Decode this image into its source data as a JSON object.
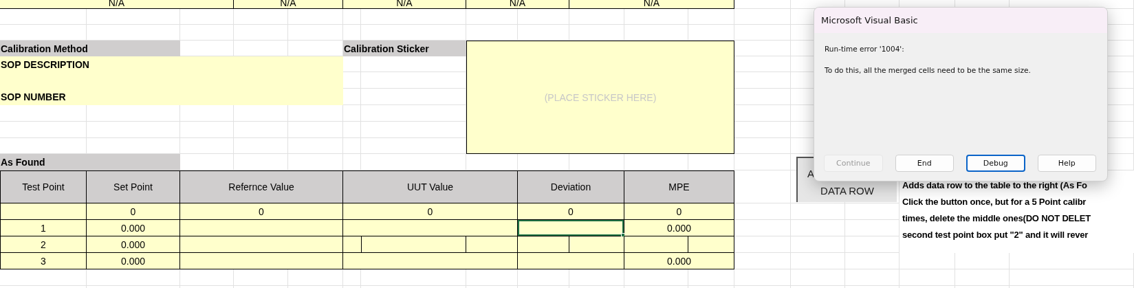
{
  "top_row": [
    "N/A",
    "N/A",
    "N/A",
    "N/A",
    "N/A"
  ],
  "calibration_method": {
    "header": "Calibration Method",
    "lines": [
      "SOP DESCRIPTION",
      "SOP NUMBER"
    ]
  },
  "calibration_sticker": {
    "header": "Calibration Sticker",
    "note": "(PLACE STICKER HERE)"
  },
  "as_found": {
    "title": "As Found",
    "columns": [
      "Test Point",
      "Set Point",
      "Refernce Value",
      "UUT Value",
      "Deviation",
      "MPE"
    ],
    "rows": [
      {
        "kind": "plain",
        "cells": [
          {
            "selected": false
          },
          {
            "text": "0",
            "selected": false
          },
          {
            "text": "0",
            "selected": false
          },
          {
            "text": "0",
            "selected": false
          },
          {
            "text": "0",
            "selected": false
          },
          {
            "text": "0",
            "selected": false
          }
        ]
      },
      {
        "kind": "plain",
        "cells": [
          {
            "text": "1",
            "selected": false
          },
          {
            "text": "0.000",
            "selected": false
          },
          {
            "selected": false
          },
          {
            "selected": false
          },
          {
            "selected": true
          },
          {
            "text": "0.000",
            "selected": false
          }
        ]
      },
      {
        "kind": "split",
        "cells": [
          {
            "text": "2",
            "selected": false
          },
          {
            "text": "0.000",
            "selected": false
          },
          {
            "selected": false
          },
          {
            "selected": false
          },
          {
            "selected": false
          },
          {
            "selected": false
          }
        ]
      },
      {
        "kind": "plain",
        "cells": [
          {
            "text": "3",
            "selected": false
          },
          {
            "text": "0.000",
            "selected": false
          },
          {
            "selected": false
          },
          {
            "selected": false
          },
          {
            "selected": false
          },
          {
            "text": "0.000",
            "selected": false
          }
        ]
      }
    ]
  },
  "add_button": {
    "label_lines": [
      "A",
      "DATA ROW"
    ]
  },
  "instructions": [
    "Adds data row to the table to the right (As Fo",
    "Click the button once, but for a 5 Point calibr",
    "times, delete the middle ones(DO NOT DELET",
    "second test point box put \"2\" and it will rever"
  ],
  "dialog": {
    "title": "Microsoft Visual Basic",
    "error": "Run-time error '1004':",
    "message": "To do this, all the merged cells need to be the same size.",
    "buttons": [
      {
        "label": "Continue",
        "disabled": true,
        "default": false
      },
      {
        "label": "End",
        "disabled": false,
        "default": false
      },
      {
        "label": "Debug",
        "disabled": false,
        "default": true
      },
      {
        "label": "Help",
        "disabled": false,
        "default": false
      }
    ]
  }
}
